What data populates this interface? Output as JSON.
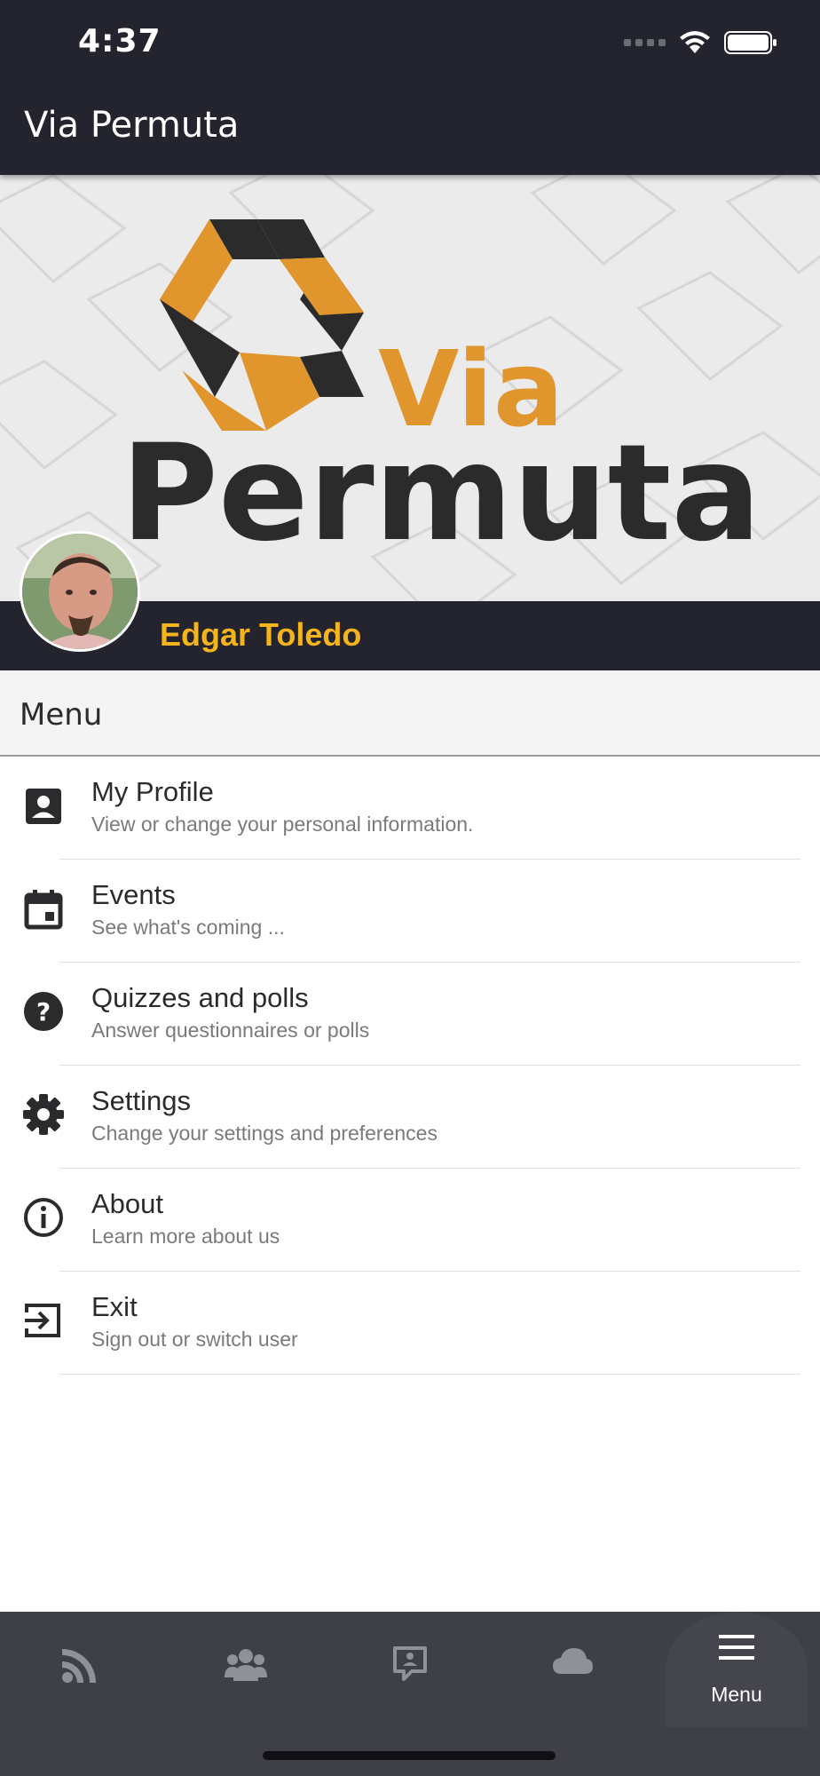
{
  "status_bar": {
    "time": "4:37"
  },
  "app_bar": {
    "title": "Via Permuta"
  },
  "banner": {
    "logo_word_1": "Via",
    "logo_word_2": "Permuta"
  },
  "user": {
    "name": "Edgar Toledo"
  },
  "menu": {
    "header": "Menu",
    "items": [
      {
        "title": "My Profile",
        "subtitle": "View or change your personal information.",
        "icon": "contact-card-icon"
      },
      {
        "title": "Events",
        "subtitle": "See what's coming ...",
        "icon": "calendar-icon"
      },
      {
        "title": "Quizzes and polls",
        "subtitle": "Answer questionnaires or polls",
        "icon": "help-circle-icon"
      },
      {
        "title": "Settings",
        "subtitle": "Change your settings and preferences",
        "icon": "gear-icon"
      },
      {
        "title": "About",
        "subtitle": "Learn more about us",
        "icon": "info-icon"
      },
      {
        "title": "Exit",
        "subtitle": "Sign out or switch user",
        "icon": "exit-icon"
      }
    ]
  },
  "tabbar": {
    "tabs": [
      {
        "icon": "rss-feed-icon",
        "label": ""
      },
      {
        "icon": "people-icon",
        "label": ""
      },
      {
        "icon": "chat-bubble-icon",
        "label": ""
      },
      {
        "icon": "cloud-icon",
        "label": ""
      },
      {
        "icon": "hamburger-menu-icon",
        "label": "Menu",
        "active": true
      }
    ]
  },
  "colors": {
    "bar_bg": "#23242d",
    "accent_name": "#f5b41c",
    "logo_orange": "#e1952d",
    "logo_dark": "#2b2b2b",
    "tabbar_bg": "#3e3f47"
  }
}
